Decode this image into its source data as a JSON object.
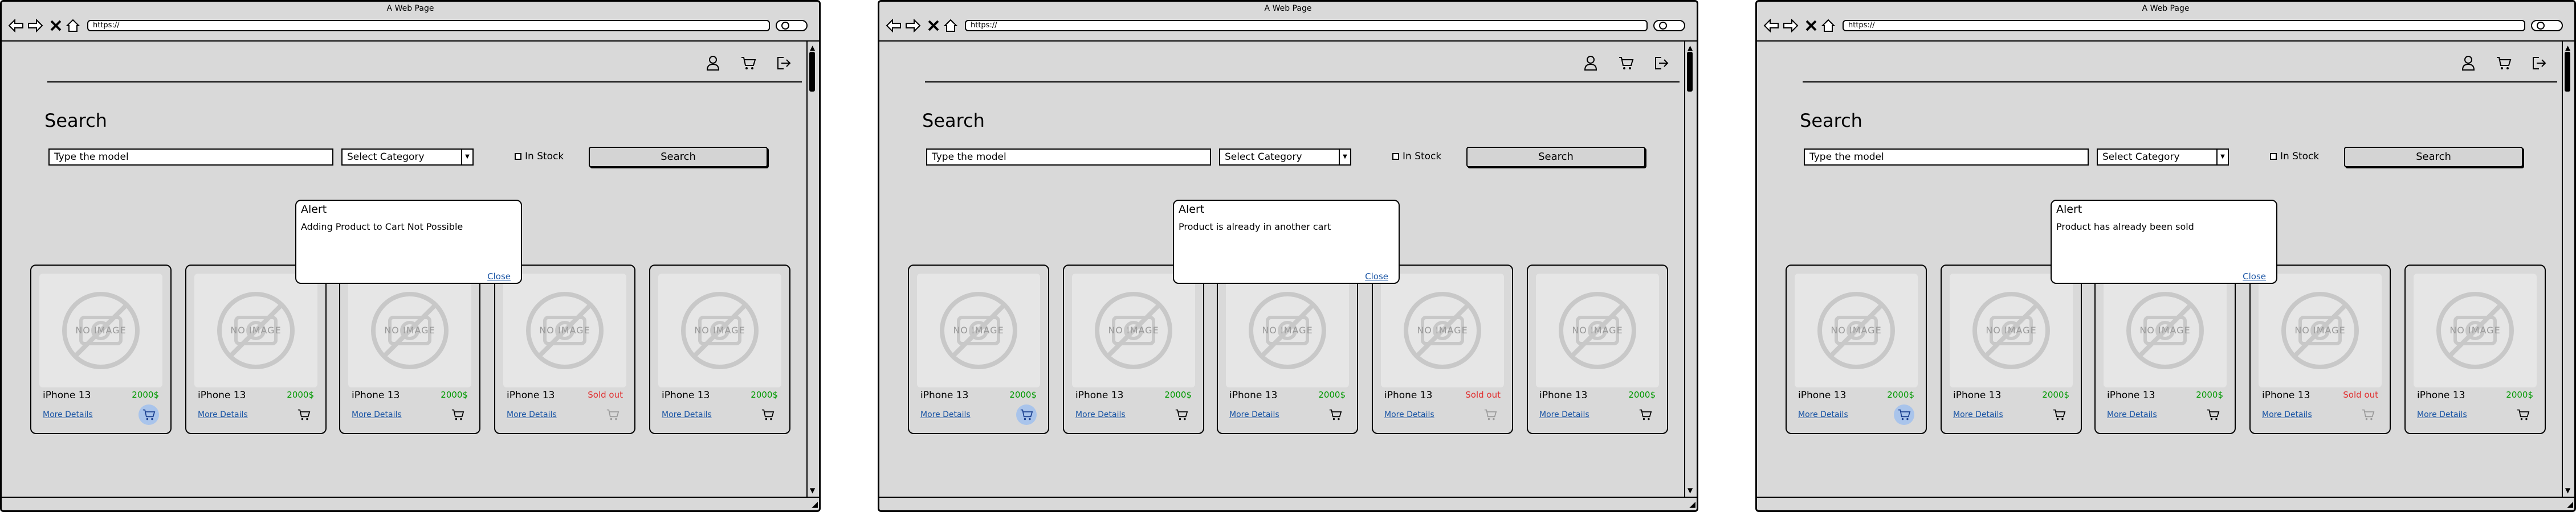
{
  "window_title": "A Web Page",
  "url": "https://",
  "search": {
    "title": "Search",
    "model_placeholder": "Type the model",
    "category_label": "Select Category",
    "instock_label": "In Stock",
    "button_label": "Search"
  },
  "no_image_label": "NO IMAGE",
  "product_card": {
    "name": "iPhone 13",
    "details_label": "More Details",
    "sold_out_label": "Sold out",
    "price": "2000$"
  },
  "cards": [
    {
      "status": "price",
      "cart": "active"
    },
    {
      "status": "price",
      "cart": "normal"
    },
    {
      "status": "price",
      "cart": "normal"
    },
    {
      "status": "sold",
      "cart": "disabled"
    },
    {
      "status": "price",
      "cart": "normal"
    }
  ],
  "colors": {
    "price": "#009900",
    "sold_out": "#e03030",
    "link": "#1a55a5",
    "active_cart_bg": "#a9c4eb"
  },
  "alert_title": "Alert",
  "alert_close": "Close",
  "screens": [
    {
      "alert_message": "Adding Product to Cart Not Possible"
    },
    {
      "alert_message": "Product is already in another cart"
    },
    {
      "alert_message": "Product has already been sold"
    }
  ]
}
